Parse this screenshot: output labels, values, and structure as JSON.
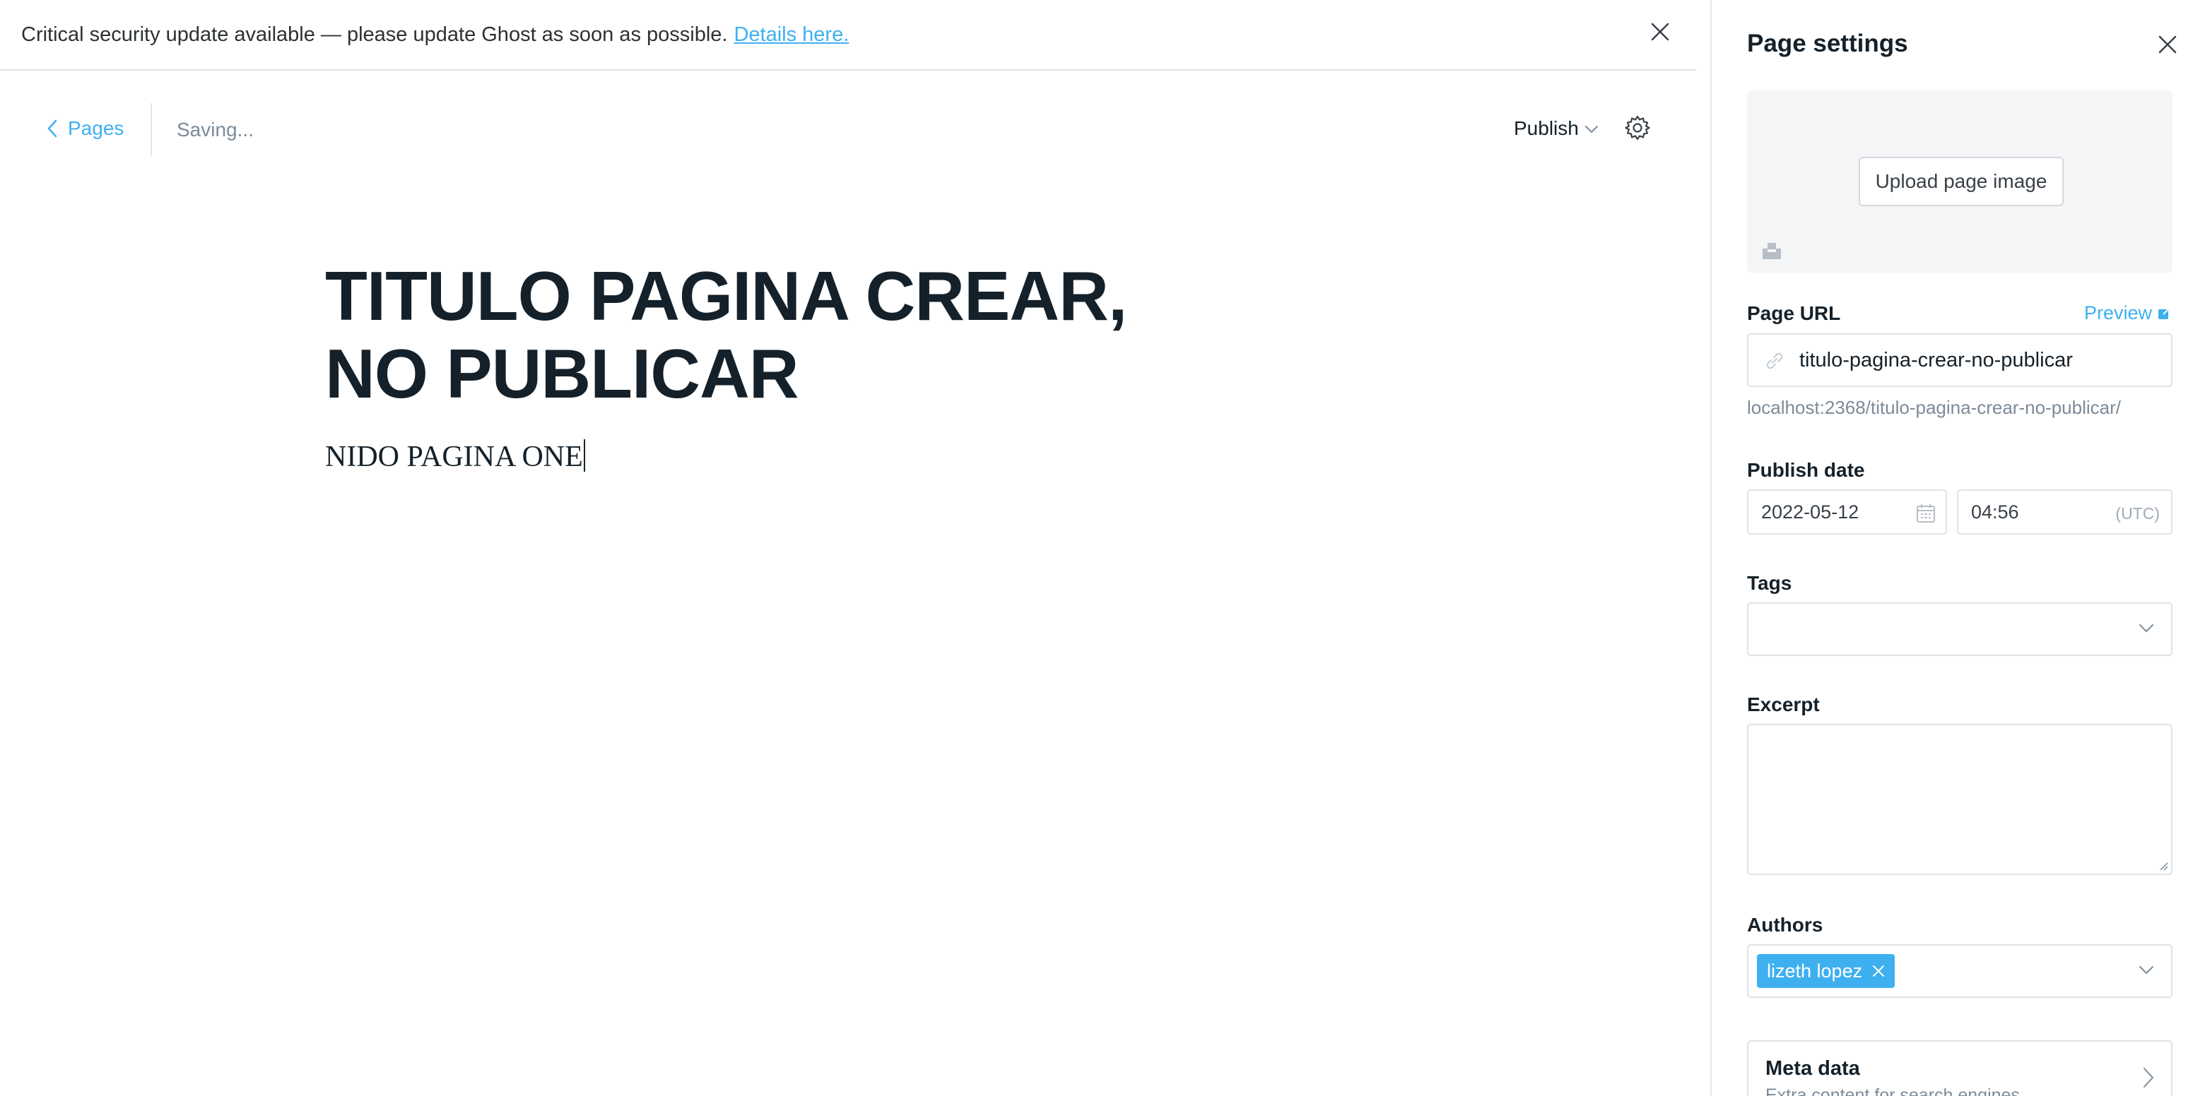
{
  "alert": {
    "message": "Critical security update available — please update Ghost as soon as possible.",
    "link_text": "Details here."
  },
  "header": {
    "back_label": "Pages",
    "status": "Saving...",
    "publish_label": "Publish"
  },
  "editor": {
    "title": "TITULO PAGINA CREAR, NO PUBLICAR",
    "body": "NIDO PAGINA ONE"
  },
  "panel": {
    "title": "Page settings",
    "upload_label": "Upload page image",
    "url": {
      "label": "Page URL",
      "preview_label": "Preview",
      "value": "titulo-pagina-crear-no-publicar",
      "hint": "localhost:2368/titulo-pagina-crear-no-publicar/"
    },
    "publish_date": {
      "label": "Publish date",
      "date": "2022-05-12",
      "time": "04:56",
      "timezone": "(UTC)"
    },
    "tags": {
      "label": "Tags"
    },
    "excerpt": {
      "label": "Excerpt"
    },
    "authors": {
      "label": "Authors",
      "items": [
        "lizeth lopez"
      ]
    },
    "meta": {
      "title": "Meta data",
      "subtitle": "Extra content for search engines"
    }
  },
  "colors": {
    "accent": "#3eb0ef",
    "text": "#15212a",
    "muted": "#7c8b9a",
    "border": "#dfe2e6"
  },
  "icons": [
    "close-icon",
    "chevron-left-icon",
    "chevron-down-icon",
    "gear-icon",
    "unsplash-icon",
    "external-link-icon",
    "link-icon",
    "calendar-icon",
    "resize-handle-icon",
    "chevron-right-icon"
  ]
}
